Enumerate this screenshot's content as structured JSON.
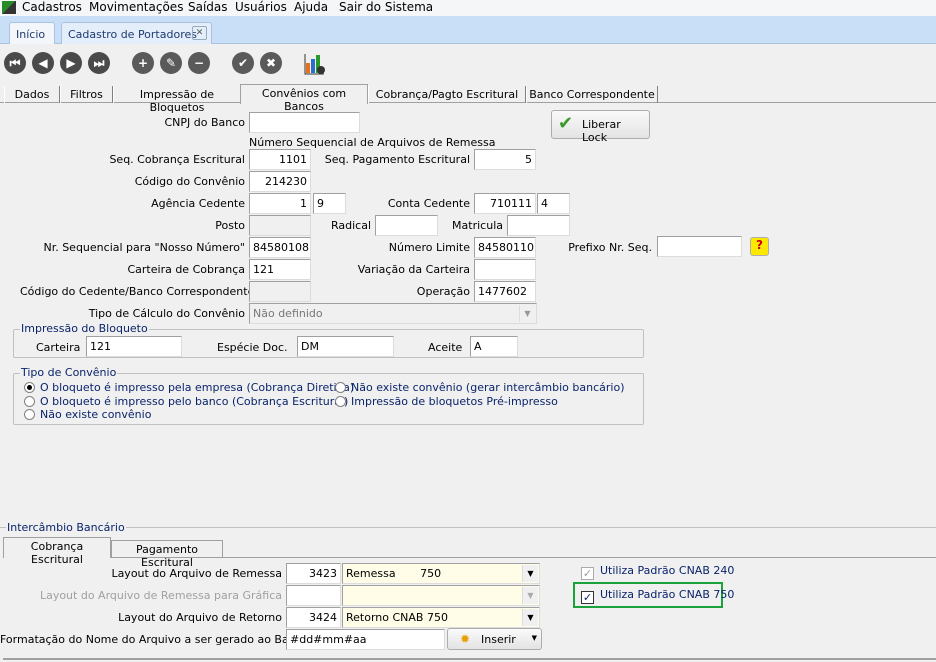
{
  "menu": [
    "Cadastros",
    "Movimentações",
    "Saídas",
    "Usuários",
    "Ajuda",
    "Sair do Sistema"
  ],
  "window_tabs": {
    "home": "Início",
    "active": "Cadastro de Portadores"
  },
  "subtabs": [
    "Dados",
    "Filtros",
    "Impressão de Bloquetos",
    "Convênios com Bancos",
    "Cobrança/Pagto Escritural",
    "Banco Correspondente"
  ],
  "form": {
    "cnpj_label": "CNPJ do Banco",
    "cnpj": "",
    "seq_header": "Número Sequencial de Arquivos de Remessa",
    "seq_cob_label": "Seq. Cobrança Escritural",
    "seq_cob": "1101",
    "seq_pag_label": "Seq. Pagamento Escritural",
    "seq_pag": "5",
    "codigo_convenio_label": "Código do Convênio",
    "codigo_convenio": "214230",
    "agencia_label": "Agência Cedente",
    "agencia": "1",
    "agencia_dv": "9",
    "conta_label": "Conta Cedente",
    "conta": "710111",
    "conta_dv": "4",
    "posto_label": "Posto",
    "radical_label": "Radical",
    "matricula_label": "Matricula",
    "nosso_numero_label": "Nr. Sequencial para \"Nosso Número\"",
    "nosso_numero": "84580108",
    "limite_label": "Número Limite",
    "limite": "84580110",
    "prefixo_label": "Prefixo Nr. Seq.",
    "prefixo": "",
    "carteira_label": "Carteira de Cobrança",
    "carteira": "121",
    "variacao_label": "Variação da Carteira",
    "variacao": "",
    "cedente_corr_label": "Código do Cedente/Banco Correspondente",
    "operacao_label": "Operação",
    "operacao": "1477602",
    "tipo_calculo_label": "Tipo de Cálculo do Convênio",
    "tipo_calculo": "Não definido",
    "liberar_lock": "Liberar Lock"
  },
  "impressao": {
    "title": "Impressão do Bloqueto",
    "carteira_label": "Carteira",
    "carteira": "121",
    "especie_label": "Espécie Doc.",
    "especie": "DM",
    "aceite_label": "Aceite",
    "aceite": "A"
  },
  "tipo_convenio": {
    "title": "Tipo de Convênio",
    "options": [
      "O bloqueto é impresso pela empresa (Cobrança Diretiva)",
      "O bloqueto é impresso pelo banco (Cobrança Escritural)",
      "Não existe convênio",
      "Não existe convênio (gerar intercâmbio bancário)",
      "Impressão de bloquetos Pré-impresso"
    ],
    "selected": 0
  },
  "intercambio": {
    "title": "Intercâmbio Bancário",
    "tabs": [
      "Cobrança Escritural",
      "Pagamento Escritural"
    ],
    "remessa_label": "Layout do Arquivo de Remessa",
    "remessa_code": "3423",
    "remessa_name": "Remessa       750",
    "grafica_label": "Layout do Arquivo de Remessa para Gráfica",
    "retorno_label": "Layout do Arquivo de Retorno",
    "retorno_code": "3424",
    "retorno_name": "Retorno CNAB 750",
    "formatacao_label": "Formatação do Nome do Arquivo a ser gerado ao Banco",
    "formatacao": "#dd#mm#aa",
    "inserir": "Inserir",
    "cnab240_label": "Utiliza Padrão CNAB 240",
    "cnab240": true,
    "cnab750_label": "Utiliza Padrão CNAB 750",
    "cnab750": true,
    "highlight_color": "#1aa33a"
  }
}
